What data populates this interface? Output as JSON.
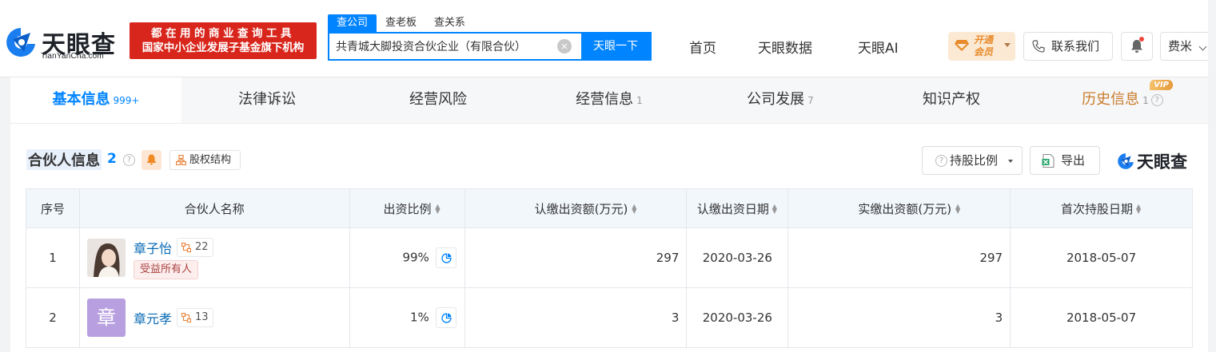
{
  "header": {
    "brand_name": "天眼查",
    "brand_domain": "TianYanCha.com",
    "slogan_line1": "都在用的商业查询工具",
    "slogan_line2": "国家中小企业发展子基金旗下机构",
    "search_tabs": [
      "查公司",
      "查老板",
      "查关系"
    ],
    "search_value": "共青城大脚投资合伙企业（有限合伙）",
    "search_button": "天眼一下",
    "clear_symbol": "×",
    "nav": [
      "首页",
      "天眼数据",
      "天眼AI"
    ],
    "vip_line1": "开通",
    "vip_line2": "会员",
    "contact_label": "联系我们",
    "user_label": "费米"
  },
  "tabs": [
    {
      "label": "基本信息",
      "count": "999+"
    },
    {
      "label": "法律诉讼",
      "count": ""
    },
    {
      "label": "经营风险",
      "count": ""
    },
    {
      "label": "经营信息",
      "count": "1"
    },
    {
      "label": "公司发展",
      "count": "7"
    },
    {
      "label": "知识产权",
      "count": ""
    },
    {
      "label": "历史信息",
      "count": "1",
      "badge": "VIP"
    }
  ],
  "section": {
    "title": "合伙人信息",
    "count": "2",
    "equity_label": "股权结构",
    "ratio_button": "持股比例",
    "export_button": "导出",
    "brand_small": "天眼查",
    "help_symbol": "?"
  },
  "table": {
    "headers": [
      "序号",
      "合伙人名称",
      "出资比例",
      "认缴出资额(万元)",
      "认缴出资日期",
      "实缴出资额(万元)",
      "首次持股日期"
    ],
    "sort_symbol": "▲▼",
    "rows": [
      {
        "index": "1",
        "name": "章子怡",
        "relations": "22",
        "tag": "受益所有人",
        "ratio": "99%",
        "subscribed": "297",
        "subscribed_date": "2020-03-26",
        "paid": "297",
        "first_date": "2018-05-07"
      },
      {
        "index": "2",
        "name": "章元孝",
        "avatar_char": "章",
        "relations": "13",
        "tag": "",
        "ratio": "1%",
        "subscribed": "3",
        "subscribed_date": "2020-03-26",
        "paid": "3",
        "first_date": "2018-05-07"
      }
    ]
  },
  "colors": {
    "primary": "#0084ff",
    "brand_red": "#d9261c",
    "vip_gold": "#e88a2a",
    "link": "#0a6bb5"
  }
}
